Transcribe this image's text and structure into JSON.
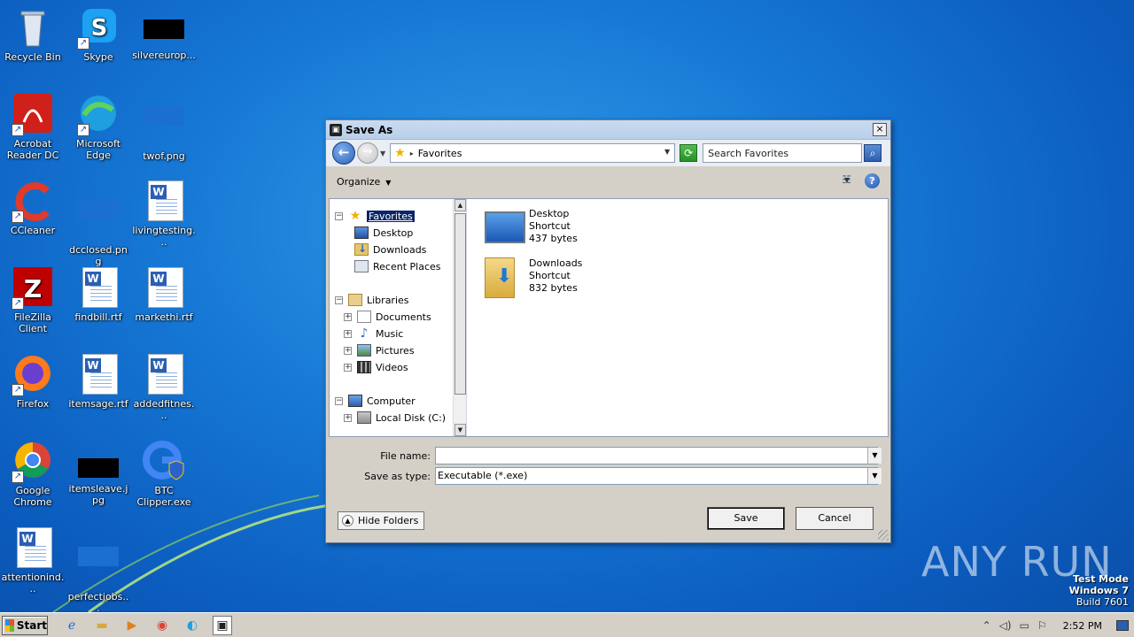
{
  "desktop": {
    "icons": [
      {
        "label": "Recycle Bin"
      },
      {
        "label": "Skype"
      },
      {
        "label": "silvereurop..."
      },
      {
        "label": "Acrobat Reader DC"
      },
      {
        "label": "Microsoft Edge"
      },
      {
        "label": "twof.png"
      },
      {
        "label": "CCleaner"
      },
      {
        "label": "dcclosed.png"
      },
      {
        "label": "livingtesting..."
      },
      {
        "label": "FileZilla Client"
      },
      {
        "label": "findbill.rtf"
      },
      {
        "label": "markethi.rtf"
      },
      {
        "label": "Firefox"
      },
      {
        "label": "itemsage.rtf"
      },
      {
        "label": "addedfitnes..."
      },
      {
        "label": "Google Chrome"
      },
      {
        "label": "itemsleave.jpg"
      },
      {
        "label": "BTC Clipper.exe"
      },
      {
        "label": "attentionind..."
      },
      {
        "label": "perfectjobs..."
      }
    ]
  },
  "dialog": {
    "title": "Save As",
    "close_glyph": "×",
    "address": {
      "location": "Favorites"
    },
    "search": {
      "placeholder": "Search Favorites"
    },
    "toolbar": {
      "organize_label": "Organize",
      "help_glyph": "?"
    },
    "tree": [
      {
        "label": "Favorites",
        "expander": "−",
        "icon": "star-icon",
        "selected": true
      },
      {
        "label": "Desktop",
        "icon": "desktop-icon"
      },
      {
        "label": "Downloads",
        "icon": "downloads-icon"
      },
      {
        "label": "Recent Places",
        "icon": "recent-places-icon"
      },
      {
        "label": "Libraries",
        "expander": "−",
        "icon": "library-icon"
      },
      {
        "label": "Documents",
        "expander": "+",
        "icon": "documents-icon"
      },
      {
        "label": "Music",
        "expander": "+",
        "icon": "music-icon"
      },
      {
        "label": "Pictures",
        "expander": "+",
        "icon": "pictures-icon"
      },
      {
        "label": "Videos",
        "expander": "+",
        "icon": "videos-icon"
      },
      {
        "label": "Computer",
        "expander": "−",
        "icon": "computer-icon"
      },
      {
        "label": "Local Disk (C:)",
        "expander": "+",
        "icon": "disk-icon"
      }
    ],
    "files": [
      {
        "name": "Desktop",
        "type": "Shortcut",
        "size": "437 bytes"
      },
      {
        "name": "Downloads",
        "type": "Shortcut",
        "size": "832 bytes"
      }
    ],
    "form": {
      "filename_label": "File name:",
      "filename_value": "",
      "savetype_label": "Save as type:",
      "savetype_value": "Executable (*.exe)"
    },
    "buttons": {
      "hide_folders": "Hide Folders",
      "save": "Save",
      "cancel": "Cancel"
    }
  },
  "taskbar": {
    "start_label": "Start",
    "clock": "2:52 PM"
  },
  "watermark": "ANY RUN",
  "os_info": {
    "line1": "Test Mode",
    "line2": "Windows 7",
    "line3": "Build 7601"
  },
  "colors": {
    "selection": "#0a246a",
    "wallpaper": "#1677d4"
  }
}
